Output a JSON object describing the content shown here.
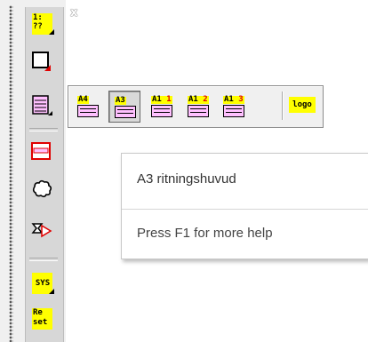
{
  "palette": {
    "close_label": "x",
    "tools": {
      "number_label": "1:\n??",
      "sys_label": "SYS",
      "reset_label": "Re\nset"
    }
  },
  "flyout": {
    "buttons": [
      {
        "name": "A4",
        "suffix": "",
        "selected": false
      },
      {
        "name": "A3",
        "suffix": "",
        "selected": true
      },
      {
        "name": "A1",
        "suffix": "1",
        "selected": false
      },
      {
        "name": "A1",
        "suffix": "2",
        "selected": false
      },
      {
        "name": "A1",
        "suffix": "3",
        "selected": false
      }
    ],
    "logo_label": "logo"
  },
  "tooltip": {
    "title": "A3 ritningshuvud",
    "help": "Press F1 for more help"
  },
  "colors": {
    "accent_yellow": "#ffff00",
    "sheet_pink": "#ffc0ff",
    "marker_red": "#e00000"
  }
}
